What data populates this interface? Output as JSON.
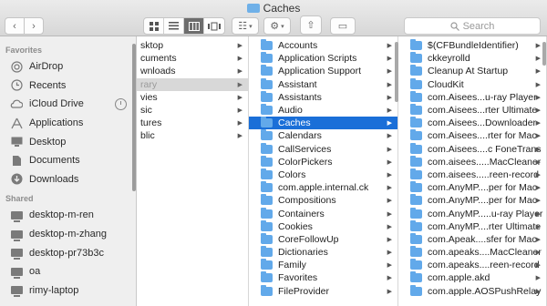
{
  "window": {
    "title": "Caches"
  },
  "toolbar": {
    "back_label": "‹",
    "forward_label": "›",
    "arrange_label": "☷",
    "action_label": "⚙",
    "share_label": "⇧",
    "tag_label": "▭",
    "search_placeholder": "Search"
  },
  "sidebar": {
    "favorites_heading": "Favorites",
    "favorites": [
      {
        "label": "AirDrop",
        "icon": "airdrop-icon"
      },
      {
        "label": "Recents",
        "icon": "clock-icon"
      },
      {
        "label": "iCloud Drive",
        "icon": "cloud-icon"
      },
      {
        "label": "Applications",
        "icon": "applications-icon"
      },
      {
        "label": "Desktop",
        "icon": "desktop-icon"
      },
      {
        "label": "Documents",
        "icon": "document-icon"
      },
      {
        "label": "Downloads",
        "icon": "download-icon"
      }
    ],
    "shared_heading": "Shared",
    "shared": [
      {
        "label": "desktop-m-ren"
      },
      {
        "label": "desktop-m-zhang"
      },
      {
        "label": "desktop-pr73b3c"
      },
      {
        "label": "oa"
      },
      {
        "label": "rimy-laptop"
      }
    ]
  },
  "column1": [
    {
      "label": "sktop",
      "state": "normal"
    },
    {
      "label": "cuments",
      "state": "normal"
    },
    {
      "label": "wnloads",
      "state": "normal"
    },
    {
      "label": "rary",
      "state": "grey"
    },
    {
      "label": "vies",
      "state": "normal"
    },
    {
      "label": "sic",
      "state": "normal"
    },
    {
      "label": "tures",
      "state": "normal"
    },
    {
      "label": "blic",
      "state": "normal"
    }
  ],
  "column2": [
    {
      "label": "Accounts",
      "state": "normal"
    },
    {
      "label": "Application Scripts",
      "state": "normal"
    },
    {
      "label": "Application Support",
      "state": "normal"
    },
    {
      "label": "Assistant",
      "state": "normal"
    },
    {
      "label": "Assistants",
      "state": "normal"
    },
    {
      "label": "Audio",
      "state": "normal"
    },
    {
      "label": "Caches",
      "state": "selected"
    },
    {
      "label": "Calendars",
      "state": "normal"
    },
    {
      "label": "CallServices",
      "state": "normal"
    },
    {
      "label": "ColorPickers",
      "state": "normal"
    },
    {
      "label": "Colors",
      "state": "normal"
    },
    {
      "label": "com.apple.internal.ck",
      "state": "normal"
    },
    {
      "label": "Compositions",
      "state": "normal"
    },
    {
      "label": "Containers",
      "state": "normal"
    },
    {
      "label": "Cookies",
      "state": "normal"
    },
    {
      "label": "CoreFollowUp",
      "state": "normal"
    },
    {
      "label": "Dictionaries",
      "state": "normal"
    },
    {
      "label": "Family",
      "state": "normal"
    },
    {
      "label": "Favorites",
      "state": "normal"
    },
    {
      "label": "FileProvider",
      "state": "normal"
    }
  ],
  "column3": [
    {
      "label": "$(CFBundleIdentifier)"
    },
    {
      "label": "ckkeyrolld"
    },
    {
      "label": "Cleanup At Startup"
    },
    {
      "label": "CloudKit"
    },
    {
      "label": "com.Aisees...u-ray Player"
    },
    {
      "label": "com.Aisees...rter Ultimate"
    },
    {
      "label": "com.Aisees...Downloader"
    },
    {
      "label": "com.Aisees....rter for Mac"
    },
    {
      "label": "com.Aisees....c FoneTrans"
    },
    {
      "label": "com.aisees.....MacCleaner"
    },
    {
      "label": "com.aisees.....reen-record"
    },
    {
      "label": "com.AnyMP....per for Mac"
    },
    {
      "label": "com.AnyMP....per for Mac"
    },
    {
      "label": "com.AnyMP.....u-ray Player"
    },
    {
      "label": "com.AnyMP....rter Ultimate"
    },
    {
      "label": "com.Apeak....sfer for Mac"
    },
    {
      "label": "com.apeaks....MacCleaner"
    },
    {
      "label": "com.apeaks....reen-record"
    },
    {
      "label": "com.apple.akd"
    },
    {
      "label": "com.apple.AOSPushRelay"
    }
  ]
}
